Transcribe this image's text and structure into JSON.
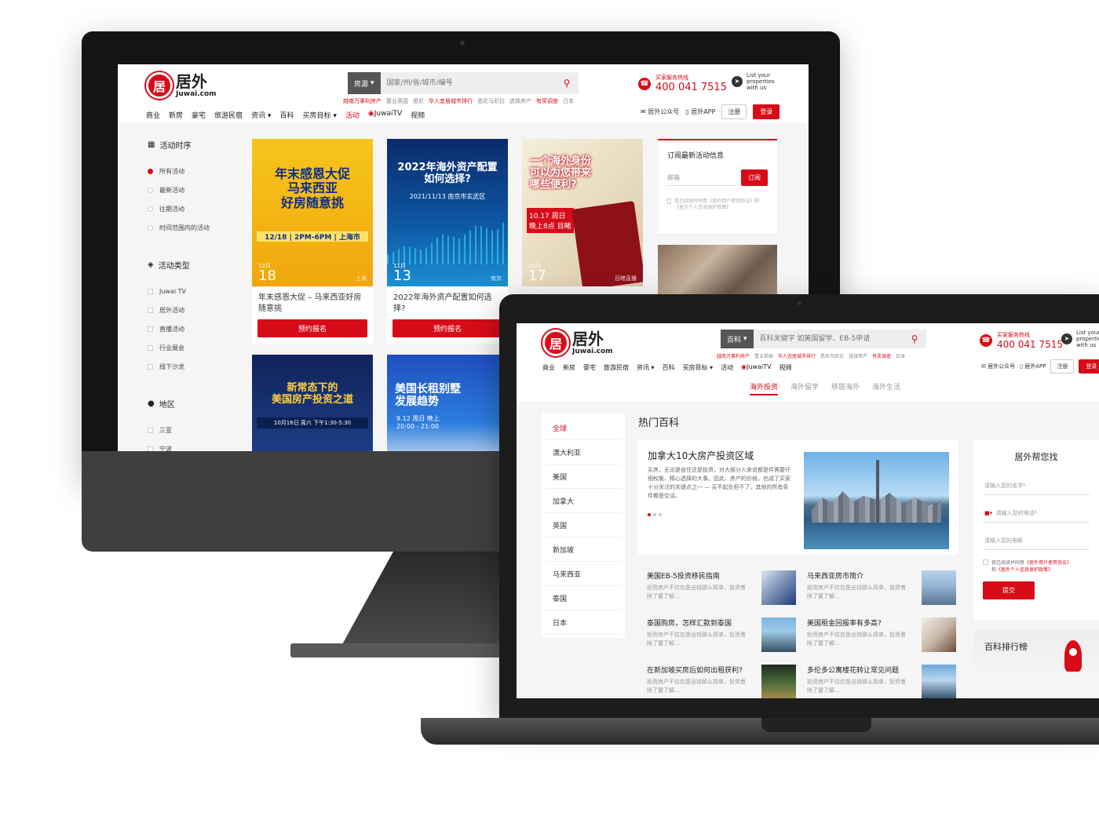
{
  "brand": {
    "cn": "居外",
    "en": "Juwai.com",
    "mark": "居"
  },
  "colors": {
    "accent": "#d70c18"
  },
  "desktop": {
    "search": {
      "category": "房源",
      "placeholder": "国家/州/省/城市/编号"
    },
    "hot_links": [
      "越南万事利房产",
      "置业英国",
      "悉尼",
      "华人宜居城市排行",
      "悉尼马尼拉",
      "选择房产",
      "有奖调查",
      "日本"
    ],
    "hotline": {
      "label": "买家服务热线",
      "number": "400 041 7515"
    },
    "list_property": [
      "List your",
      "properties",
      "with us"
    ],
    "nav": [
      "商业",
      "新房",
      "豪宅",
      "旅游民宿",
      "资讯 ▾",
      "百科",
      "买房目标 ▾",
      "活动",
      "JuwaiTV",
      "视频"
    ],
    "header_right": {
      "wechat": "居外公众号",
      "app": "居外APP",
      "register": "注册",
      "login": "登录"
    },
    "sidebar": {
      "time_title": "活动时序",
      "time_items": [
        "所有活动",
        "最新活动",
        "往期活动",
        "时间范围内的活动"
      ],
      "type_title": "活动类型",
      "type_items": [
        "Juwai TV",
        "居外活动",
        "直播活动",
        "行业展会",
        "线下沙龙"
      ],
      "region_title": "地区",
      "region_items": [
        "三亚",
        "宁波"
      ]
    },
    "cards": [
      {
        "headline": "年末感恩大促\n马来西亚\n好房随意挑",
        "tag": "12/18 | 2PM-6PM | 上海市",
        "month": "12月",
        "day": "18",
        "city": "上海",
        "title": "年末感恩大促 – 马来西亚好房随意挑",
        "button": "预约报名"
      },
      {
        "headline": "2022年海外资产配置如何选择?",
        "tag": "2021/11/13 南京市玄武区",
        "month": "11月",
        "day": "13",
        "city": "南京",
        "title": "2022年海外资产配置如何选择?",
        "button": "预约报名"
      },
      {
        "headline": "一个海外身份\n可以为您带来\n哪些便利?",
        "tag": "10.17 周日 晚上8点 目睹",
        "month": "10月",
        "day": "17",
        "city": "目睹直播",
        "title": "一个海外身份可以为您带来哪些便利?",
        "button": ""
      },
      {
        "headline": "新常态下的\n美国房产投资之道",
        "tag": "10月16日 周六 下午1:30-5:30",
        "title": ""
      },
      {
        "headline": "美国长租别墅\n发展趋势",
        "tag": "9.12 周日 晚上 20:00 - 21:00",
        "title": ""
      }
    ],
    "subscribe": {
      "title": "订阅最新活动信息",
      "placeholder": "邮箱",
      "button": "订阅",
      "agree": "我已阅读并同意《居外用户使用协议》和《居外个人信息保护政策》"
    }
  },
  "laptop": {
    "search": {
      "category": "百科",
      "placeholder": "百科关键字 如美国留学、EB-5申请"
    },
    "hot_links": [
      "越南万事利房产",
      "置业英国",
      "华人宜居城市排行",
      "悉尼马尼拉",
      "选择房产",
      "有奖调查",
      "日本"
    ],
    "hotline": {
      "label": "买家服务热线",
      "number": "400 041 7515"
    },
    "list_property": [
      "List your",
      "properties",
      "with us"
    ],
    "nav": [
      "商业",
      "新房",
      "豪宅",
      "旅游民宿",
      "资讯 ▾",
      "百科",
      "买房目标 ▾",
      "活动",
      "JuwaiTV",
      "视频"
    ],
    "header_right": {
      "wechat": "居外公众号",
      "app": "居外APP",
      "register": "注册",
      "login": "登录"
    },
    "subtabs": [
      "海外投资",
      "海外留学",
      "移居海外",
      "海外生活"
    ],
    "countries": [
      "全球",
      "澳大利亚",
      "美国",
      "加拿大",
      "英国",
      "新加坡",
      "马来西亚",
      "泰国",
      "日本"
    ],
    "section_title": "热门百科",
    "feature": {
      "title": "加拿大10大房产投资区域",
      "desc": "买房，无论是自住还是投资，对大部分人来说都是件需要仔细权衡、精心选择的大事。因此，房产的价格，也成了买家十分关注的关键点之一 — 买不起负担不了，其他的所有条件都是空谈。"
    },
    "articles": [
      {
        "title": "美国EB-5投资移民指南",
        "desc": "投资房产不仅仅是出钱那么简单，投资者除了要了解..."
      },
      {
        "title": "马来西亚房市简介",
        "desc": "投资房产不仅仅是出钱那么简单，投资者除了要了解..."
      },
      {
        "title": "泰国购房，怎样汇款到泰国",
        "desc": "投资房产不仅仅是出钱那么简单，投资者除了要了解..."
      },
      {
        "title": "美国租金回报率有多高?",
        "desc": "投资房产不仅仅是出钱那么简单，投资者除了要了解..."
      },
      {
        "title": "在新加坡买房后如何出租获利?",
        "desc": "投资房产不仅仅是出钱那么简单，投资者除了要了解..."
      },
      {
        "title": "多伦多公寓楼花转让常见问题",
        "desc": "投资房产不仅仅是出钱那么简单，投资者除了要了解..."
      }
    ],
    "help": {
      "title": "居外帮您找",
      "name": "请输入您的名字*",
      "phone": "请输入您的电话*",
      "email": "请输入您的电邮",
      "agree_prefix": "我已阅读并同意",
      "agree_link1": "《居外用户使用协议》",
      "agree_mid": "和",
      "agree_link2": "《居外个人信息保护政策》",
      "submit": "提交"
    },
    "ranking_title": "百科排行榜"
  }
}
